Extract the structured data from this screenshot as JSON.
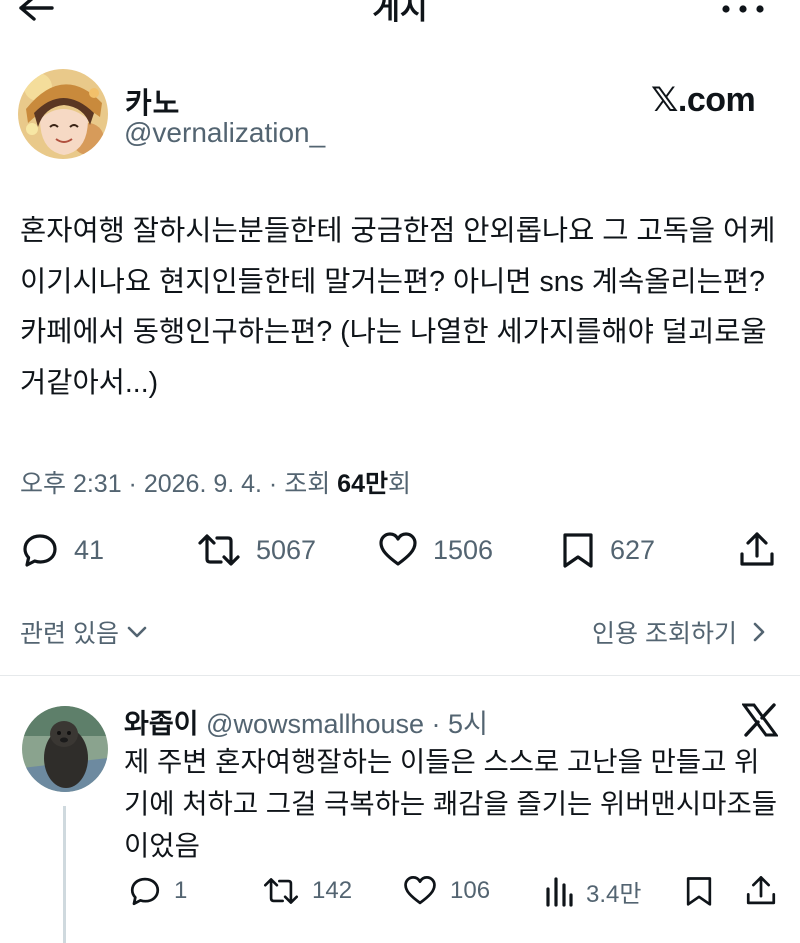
{
  "header": {
    "title": "게시",
    "back_icon": "arrow-left-icon",
    "more_icon": "more-horizontal-icon"
  },
  "post": {
    "author_name": "카노",
    "author_handle": "@vernalization_",
    "source_logo": "𝕏.com",
    "body": "혼자여행 잘하시는분들한테 궁금한점 안외롭나요 그 고독을 어케이기시나요 현지인들한테 말거는편? 아니면 sns 계속올리는편? 카페에서 동행인구하는편? (나는 나열한 세가지를해야 덜괴로울거같아서...)",
    "meta": {
      "time": "오후 2:31",
      "date": "2026. 9. 4.",
      "views_label": "조회",
      "views_count": "64만",
      "views_suffix": "회"
    },
    "actions": {
      "replies": "41",
      "reposts": "5067",
      "likes": "1506",
      "bookmarks": "627"
    },
    "related_label": "관련 있음",
    "quotes_label": "인용 조회하기"
  },
  "reply": {
    "name": "와좁이",
    "handle": "@wowsmallhouse",
    "time": "5시",
    "body": "제 주변 혼자여행잘하는 이들은 스스로 고난을 만들고 위기에 처하고 그걸 극복하는 쾌감을 즐기는 위버맨시마조들이었음",
    "actions": {
      "replies": "1",
      "reposts": "142",
      "likes": "106",
      "views": "3.4만"
    }
  },
  "colors": {
    "text": "#0f1419",
    "secondary": "#536471",
    "divider": "#e6e9eb"
  }
}
